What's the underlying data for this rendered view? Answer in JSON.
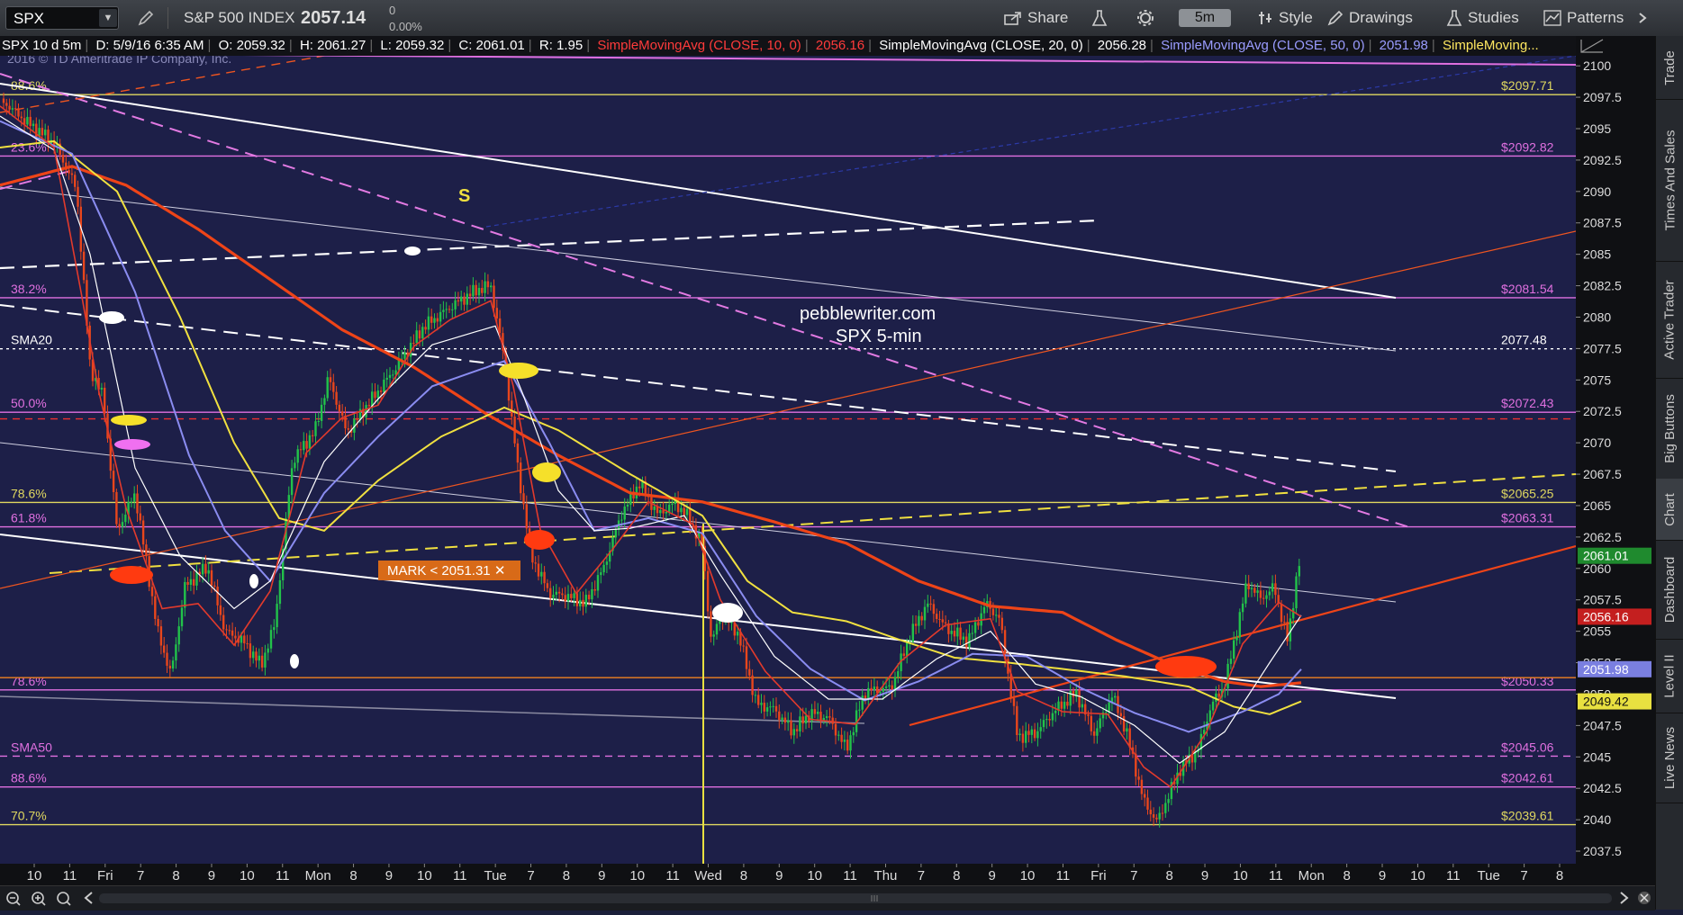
{
  "toolbar": {
    "symbol": "SPX",
    "description": "S&P 500 INDEX",
    "last": "2057.14",
    "change": "0",
    "change_pct": "0.00%",
    "share": "Share",
    "timeframe": "5m",
    "style": "Style",
    "drawings": "Drawings",
    "studies": "Studies",
    "patterns": "Patterns"
  },
  "info": {
    "title": "SPX 10 d 5m",
    "date": "D: 5/9/16 6:35 AM",
    "open": "O: 2059.32",
    "high": "H: 2061.27",
    "low": "L: 2059.32",
    "close": "C: 2061.01",
    "range": "R: 1.95",
    "sma10_label": "SimpleMovingAvg (CLOSE, 10, 0)",
    "sma10_value": "2056.16",
    "sma20_label": "SimpleMovingAvg (CLOSE, 20, 0)",
    "sma20_value": "2056.28",
    "sma50_label": "SimpleMovingAvg (CLOSE, 50, 0)",
    "sma50_value": "2051.98",
    "sma_more": "SimpleMoving..."
  },
  "copyright": "2016 © TD Ameritrade IP Company, Inc.",
  "watermark": {
    "line1": "pebblewriter.com",
    "line2": "SPX 5-min"
  },
  "s_label": "S",
  "mark": "MARK < 2051.31 ✕",
  "sidebar": [
    "Trade",
    "Times And Sales",
    "Active Trader",
    "Big Buttons",
    "Chart",
    "Dashboard",
    "Level II",
    "Live News"
  ],
  "colors": {
    "price_up": "#22c24a",
    "price_down": "#e8461c",
    "sma10": "#e23a2c",
    "sma20": "#ffffff",
    "sma50": "#8a8cf0",
    "sma100": "#f0e040",
    "sma200": "#ee4418",
    "fib": "#e070e0",
    "fib_alt": "#e0d860"
  },
  "chart_data": {
    "type": "line",
    "ylim": [
      2036.5,
      2100.8
    ],
    "yticks": [
      "2100",
      "2097.5",
      "2095",
      "2092.5",
      "2090",
      "2087.5",
      "2085",
      "2082.5",
      "2080",
      "2077.5",
      "2075",
      "2072.5",
      "2070",
      "2067.5",
      "2065",
      "2062.5",
      "2060",
      "2057.5",
      "2055",
      "2052.5",
      "2050",
      "2047.5",
      "2045",
      "2042.5",
      "2040",
      "2037.5"
    ],
    "xticks": [
      "10",
      "11",
      "Fri",
      "7",
      "8",
      "9",
      "10",
      "11",
      "Mon",
      "8",
      "9",
      "10",
      "11",
      "Tue",
      "7",
      "8",
      "9",
      "10",
      "11",
      "Wed",
      "8",
      "9",
      "10",
      "11",
      "Thu",
      "7",
      "8",
      "9",
      "10",
      "11",
      "Fri",
      "7",
      "8",
      "9",
      "10",
      "11",
      "Mon",
      "8",
      "9",
      "10",
      "11",
      "Tue",
      "7",
      "8"
    ],
    "levels": [
      {
        "price": 2097.71,
        "color": "#e0d860",
        "tag": "$2097.71",
        "left": "88.6%"
      },
      {
        "price": 2092.82,
        "color": "#e070e0",
        "tag": "$2092.82",
        "left": "23.6%"
      },
      {
        "price": 2081.54,
        "color": "#e070e0",
        "tag": "$2081.54",
        "left": "38.2%"
      },
      {
        "price": 2077.48,
        "color": "#ffffff",
        "tag": "2077.48",
        "left": "SMA20",
        "dash": "dot"
      },
      {
        "price": 2072.43,
        "color": "#e070e0",
        "tag": "$2072.43",
        "left": "50.0%"
      },
      {
        "price": 2071.9,
        "color": "#ee3030",
        "tag": "",
        "left": "",
        "dash": "dash"
      },
      {
        "price": 2065.25,
        "color": "#e0d860",
        "tag": "$2065.25",
        "left": "78.6%"
      },
      {
        "price": 2063.31,
        "color": "#e070e0",
        "tag": "$2063.31",
        "left": "61.8%"
      },
      {
        "price": 2050.33,
        "color": "#e070e0",
        "tag": "$2050.33",
        "left": "78.6%"
      },
      {
        "price": 2051.31,
        "color": "#f08020",
        "tag": "",
        "left": ""
      },
      {
        "price": 2045.06,
        "color": "#e070e0",
        "tag": "$2045.06",
        "left": "SMA50",
        "dash": "dash"
      },
      {
        "price": 2042.61,
        "color": "#e070e0",
        "tag": "$2042.61",
        "left": "88.6%"
      },
      {
        "price": 2039.61,
        "color": "#e0d860",
        "tag": "$2039.61",
        "left": "70.7%"
      }
    ],
    "axis_labels": [
      {
        "price": 2061.01,
        "text": "2061.01",
        "bg": "#1f8a2e",
        "fg": "#ffffff"
      },
      {
        "price": 2056.16,
        "text": "2056.16",
        "bg": "#c41f1f",
        "fg": "#ffffff"
      },
      {
        "price": 2051.98,
        "text": "2051.98",
        "bg": "#7a7fe0",
        "fg": "#ffffff"
      },
      {
        "price": 2049.42,
        "text": "2049.42",
        "bg": "#e8e040",
        "fg": "#111111"
      }
    ],
    "price_keys": [
      [
        0,
        2097.4
      ],
      [
        30,
        2095.5
      ],
      [
        60,
        2093.9
      ],
      [
        85,
        2090.2
      ],
      [
        100,
        2076.0
      ],
      [
        115,
        2073.5
      ],
      [
        130,
        2063.0
      ],
      [
        150,
        2066.0
      ],
      [
        175,
        2055.0
      ],
      [
        190,
        2051.5
      ],
      [
        205,
        2058.5
      ],
      [
        230,
        2060.2
      ],
      [
        250,
        2055.0
      ],
      [
        270,
        2054.2
      ],
      [
        290,
        2052.3
      ],
      [
        305,
        2055.5
      ],
      [
        325,
        2068.6
      ],
      [
        350,
        2071.0
      ],
      [
        365,
        2075.2
      ],
      [
        385,
        2070.8
      ],
      [
        410,
        2073.2
      ],
      [
        440,
        2076.0
      ],
      [
        470,
        2079.2
      ],
      [
        500,
        2080.8
      ],
      [
        530,
        2082.2
      ],
      [
        545,
        2082.5
      ],
      [
        560,
        2076.6
      ],
      [
        575,
        2068.0
      ],
      [
        590,
        2061.0
      ],
      [
        610,
        2058.0
      ],
      [
        630,
        2057.8
      ],
      [
        650,
        2057.2
      ],
      [
        670,
        2060.0
      ],
      [
        690,
        2064.3
      ],
      [
        710,
        2066.8
      ],
      [
        730,
        2064.3
      ],
      [
        750,
        2065.2
      ],
      [
        765,
        2064.0
      ],
      [
        780,
        2061.8
      ],
      [
        790,
        2054.0
      ],
      [
        800,
        2056.3
      ],
      [
        820,
        2054.8
      ],
      [
        840,
        2049.2
      ],
      [
        860,
        2048.8
      ],
      [
        880,
        2047.0
      ],
      [
        900,
        2048.5
      ],
      [
        920,
        2048.1
      ],
      [
        940,
        2045.6
      ],
      [
        960,
        2050.2
      ],
      [
        990,
        2050.5
      ],
      [
        1010,
        2054.6
      ],
      [
        1030,
        2057.2
      ],
      [
        1050,
        2055.3
      ],
      [
        1075,
        2054.2
      ],
      [
        1095,
        2057.2
      ],
      [
        1110,
        2056.0
      ],
      [
        1130,
        2046.6
      ],
      [
        1150,
        2046.9
      ],
      [
        1170,
        2048.6
      ],
      [
        1195,
        2050.1
      ],
      [
        1215,
        2046.8
      ],
      [
        1235,
        2049.9
      ],
      [
        1250,
        2047.2
      ],
      [
        1270,
        2041.5
      ],
      [
        1285,
        2039.8
      ],
      [
        1310,
        2044.0
      ],
      [
        1330,
        2045.5
      ],
      [
        1345,
        2049.1
      ],
      [
        1360,
        2050.7
      ],
      [
        1385,
        2058.9
      ],
      [
        1400,
        2057.6
      ],
      [
        1415,
        2058.5
      ],
      [
        1430,
        2054.2
      ],
      [
        1440,
        2059.4
      ],
      [
        1445,
        2061.0
      ]
    ],
    "sma10_keys": [
      [
        0,
        2096.8
      ],
      [
        60,
        2093.5
      ],
      [
        90,
        2082.0
      ],
      [
        110,
        2074.0
      ],
      [
        140,
        2064.8
      ],
      [
        180,
        2056.8
      ],
      [
        220,
        2057.2
      ],
      [
        260,
        2053.9
      ],
      [
        300,
        2058.2
      ],
      [
        340,
        2069.2
      ],
      [
        380,
        2072.0
      ],
      [
        420,
        2073.0
      ],
      [
        460,
        2077.7
      ],
      [
        500,
        2079.8
      ],
      [
        545,
        2081.3
      ],
      [
        570,
        2074.5
      ],
      [
        600,
        2063.1
      ],
      [
        640,
        2058.0
      ],
      [
        680,
        2061.5
      ],
      [
        720,
        2065.3
      ],
      [
        770,
        2063.5
      ],
      [
        800,
        2057.5
      ],
      [
        850,
        2051.8
      ],
      [
        900,
        2048.0
      ],
      [
        950,
        2047.6
      ],
      [
        1000,
        2052.6
      ],
      [
        1050,
        2055.5
      ],
      [
        1100,
        2056.0
      ],
      [
        1130,
        2050.2
      ],
      [
        1180,
        2048.6
      ],
      [
        1230,
        2048.4
      ],
      [
        1270,
        2044.2
      ],
      [
        1300,
        2042.6
      ],
      [
        1340,
        2047.0
      ],
      [
        1380,
        2054.0
      ],
      [
        1420,
        2057.3
      ],
      [
        1445,
        2056.16
      ]
    ],
    "sma20_keys": [
      [
        0,
        2096.0
      ],
      [
        60,
        2093.3
      ],
      [
        100,
        2085.0
      ],
      [
        150,
        2068.0
      ],
      [
        200,
        2061.0
      ],
      [
        260,
        2056.8
      ],
      [
        300,
        2059.0
      ],
      [
        360,
        2068.5
      ],
      [
        420,
        2073.5
      ],
      [
        480,
        2077.8
      ],
      [
        550,
        2079.3
      ],
      [
        580,
        2074.0
      ],
      [
        620,
        2066.2
      ],
      [
        660,
        2063.0
      ],
      [
        700,
        2063.2
      ],
      [
        760,
        2064.2
      ],
      [
        800,
        2059.5
      ],
      [
        860,
        2053.0
      ],
      [
        920,
        2049.6
      ],
      [
        980,
        2049.6
      ],
      [
        1040,
        2052.8
      ],
      [
        1100,
        2055.0
      ],
      [
        1150,
        2050.8
      ],
      [
        1200,
        2049.8
      ],
      [
        1260,
        2047.5
      ],
      [
        1310,
        2044.5
      ],
      [
        1360,
        2047.0
      ],
      [
        1410,
        2052.5
      ],
      [
        1445,
        2056.28
      ]
    ],
    "sma50_keys": [
      [
        0,
        2095.6
      ],
      [
        80,
        2093.0
      ],
      [
        150,
        2082.0
      ],
      [
        210,
        2069.0
      ],
      [
        250,
        2063.0
      ],
      [
        300,
        2059.0
      ],
      [
        360,
        2066.0
      ],
      [
        420,
        2070.5
      ],
      [
        480,
        2074.5
      ],
      [
        560,
        2076.5
      ],
      [
        610,
        2070.0
      ],
      [
        660,
        2063.0
      ],
      [
        720,
        2064.0
      ],
      [
        780,
        2062.8
      ],
      [
        840,
        2056.2
      ],
      [
        900,
        2052.0
      ],
      [
        960,
        2049.5
      ],
      [
        1020,
        2051.0
      ],
      [
        1080,
        2053.2
      ],
      [
        1140,
        2053.0
      ],
      [
        1200,
        2050.5
      ],
      [
        1260,
        2048.5
      ],
      [
        1320,
        2047.0
      ],
      [
        1380,
        2048.6
      ],
      [
        1420,
        2050.0
      ],
      [
        1445,
        2051.98
      ]
    ],
    "sma100_keys": [
      [
        0,
        2093.5
      ],
      [
        60,
        2094.0
      ],
      [
        130,
        2090.0
      ],
      [
        200,
        2080.0
      ],
      [
        260,
        2070.0
      ],
      [
        310,
        2064.0
      ],
      [
        360,
        2063.0
      ],
      [
        420,
        2067.0
      ],
      [
        490,
        2070.5
      ],
      [
        560,
        2072.8
      ],
      [
        620,
        2071.0
      ],
      [
        700,
        2067.5
      ],
      [
        780,
        2064.2
      ],
      [
        830,
        2059.0
      ],
      [
        880,
        2056.5
      ],
      [
        940,
        2055.8
      ],
      [
        1000,
        2054.3
      ],
      [
        1060,
        2052.9
      ],
      [
        1120,
        2052.5
      ],
      [
        1180,
        2052.0
      ],
      [
        1250,
        2051.4
      ],
      [
        1320,
        2050.6
      ],
      [
        1370,
        2049.0
      ],
      [
        1410,
        2048.4
      ],
      [
        1445,
        2049.42
      ]
    ],
    "sma200_keys": [
      [
        0,
        2090.5
      ],
      [
        80,
        2092.0
      ],
      [
        140,
        2090.5
      ],
      [
        220,
        2087.0
      ],
      [
        300,
        2083.0
      ],
      [
        380,
        2079.0
      ],
      [
        460,
        2076.0
      ],
      [
        540,
        2072.3
      ],
      [
        620,
        2069.0
      ],
      [
        700,
        2066.0
      ],
      [
        780,
        2065.3
      ],
      [
        860,
        2063.7
      ],
      [
        940,
        2062.0
      ],
      [
        1020,
        2059.0
      ],
      [
        1100,
        2057.0
      ],
      [
        1180,
        2056.5
      ],
      [
        1240,
        2054.3
      ],
      [
        1300,
        2052.4
      ],
      [
        1360,
        2051.0
      ],
      [
        1400,
        2050.6
      ],
      [
        1445,
        2050.9
      ]
    ]
  }
}
